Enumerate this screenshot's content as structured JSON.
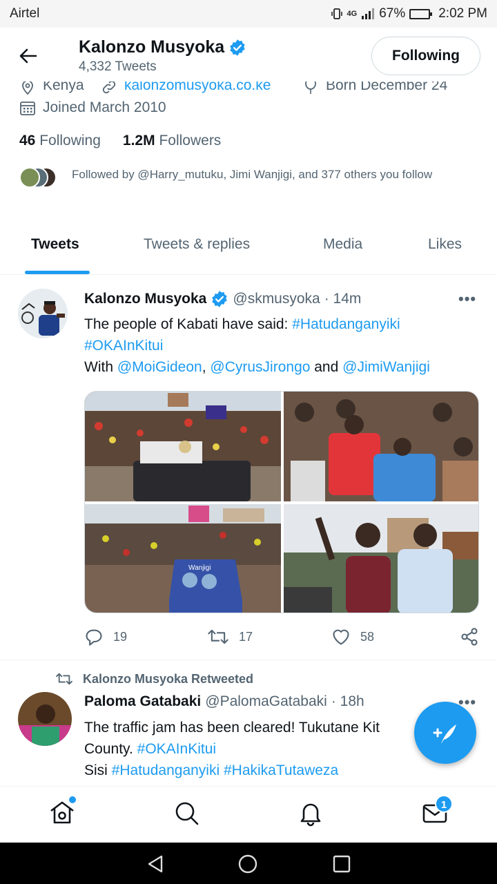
{
  "status_bar": {
    "carrier": "Airtel",
    "network": "4G",
    "battery": "67%",
    "time": "2:02 PM"
  },
  "header": {
    "name": "Kalonzo Musyoka",
    "tweet_count": "4,332 Tweets",
    "follow_label": "Following"
  },
  "profile": {
    "location": "Kenya",
    "website": "kalonzomusyoka.co.ke",
    "born": "Born December 24",
    "joined": "Joined March 2010",
    "following_count": "46",
    "following_label": "Following",
    "followers_count": "1.2M",
    "followers_label": "Followers",
    "followed_by": "Followed by @Harry_mutuku, Jimi Wanjigi, and 377 others you follow"
  },
  "tabs": [
    "Tweets",
    "Tweets & replies",
    "Media",
    "Likes"
  ],
  "tweet1": {
    "name": "Kalonzo Musyoka",
    "handle": "@skmusyoka",
    "time": "· 14m",
    "text_start": "The people of Kabati have said: ",
    "tag1": "#Hatudanganyiki",
    "tag2": "#OKAInKitui",
    "with": "With ",
    "m1": "@MoiGideon",
    "comma": ", ",
    "m2": "@CyrusJirongo",
    "and": " and ",
    "m3": "@JimiWanjigi",
    "replies": "19",
    "retweets": "17",
    "likes": "58",
    "bus_text": "Wanjigi"
  },
  "tweet2": {
    "retweeted_by": "Kalonzo Musyoka Retweeted",
    "name": "Paloma Gatabaki",
    "handle": "@PalomaGatabaki",
    "time": "· 18h",
    "line1": "The traffic jam has been cleared! Tukutane Kit",
    "line2_a": "County. ",
    "line2_tag": "#OKAInKitui",
    "line3_a": "Sisi  ",
    "line3_t1": "#Hatudanganyiki",
    "line3_t2": "#HakikaTutaweza"
  },
  "nav": {
    "messages_badge": "1"
  },
  "colors": {
    "accent": "#1d9bf0",
    "text": "#0f1419",
    "muted": "#536471"
  }
}
